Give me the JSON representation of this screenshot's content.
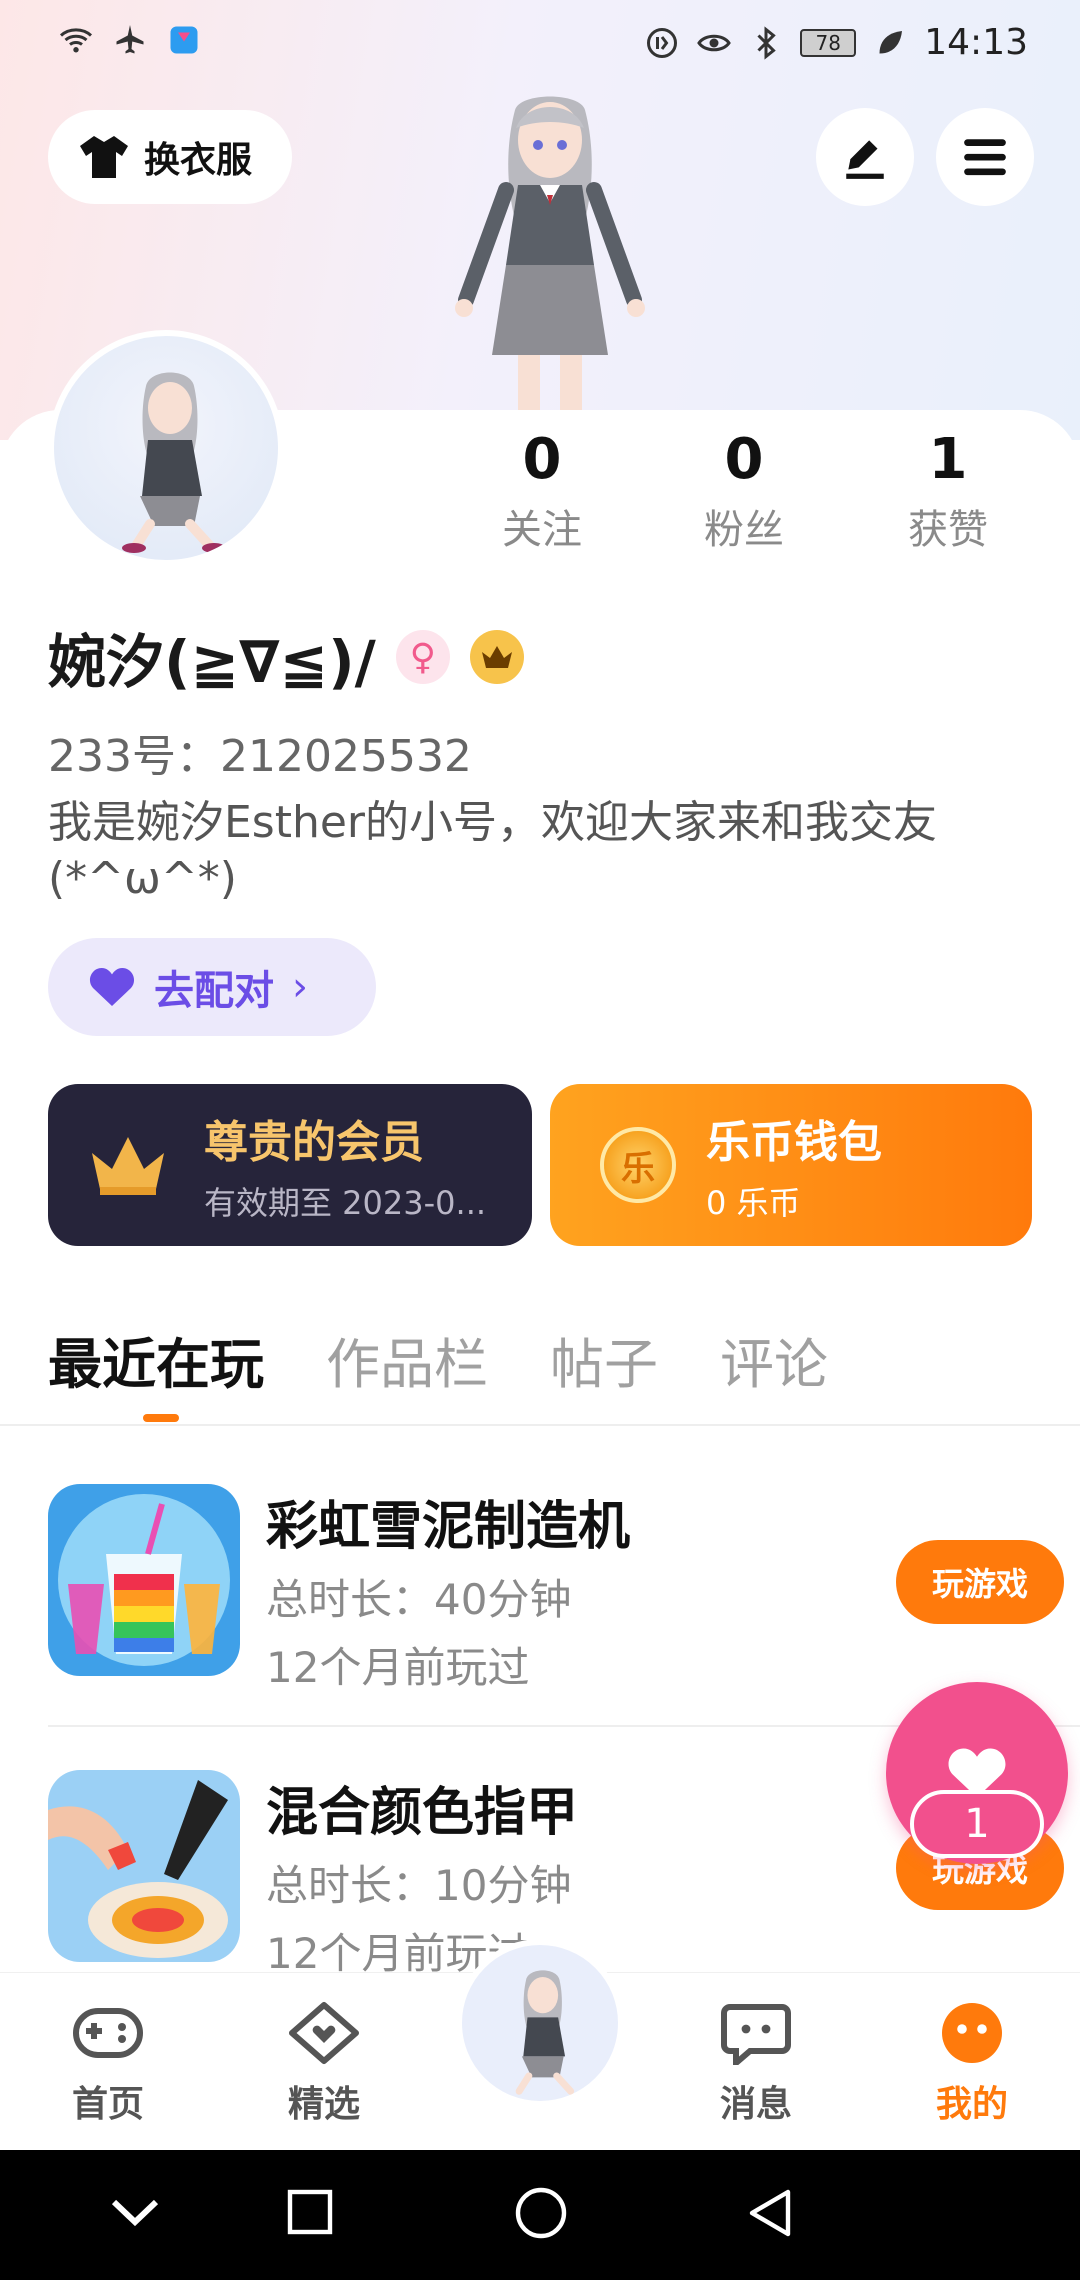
{
  "status_bar": {
    "time": "14:13",
    "battery": "78"
  },
  "header": {
    "outfit_label": "换衣服"
  },
  "profile": {
    "name": "婉汐(≧∇≦)/",
    "uid": "233号：212025532",
    "bio": "我是婉汐Esther的小号，欢迎大家来和我交友(*^ω^*)",
    "match_label": "去配对",
    "stats": [
      {
        "num": "0",
        "label": "关注"
      },
      {
        "num": "0",
        "label": "粉丝"
      },
      {
        "num": "1",
        "label": "获赞"
      }
    ]
  },
  "vip": {
    "title": "尊贵的会员",
    "subtitle": "有效期至 2023-0..."
  },
  "wallet": {
    "title": "乐币钱包",
    "subtitle": "0 乐币",
    "coin_char": "乐"
  },
  "tabs": [
    "最近在玩",
    "作品栏",
    "帖子",
    "评论"
  ],
  "games": [
    {
      "title": "彩虹雪泥制造机",
      "duration": "总时长：40分钟",
      "last_played": "12个月前玩过",
      "button": "玩游戏"
    },
    {
      "title": "混合颜色指甲",
      "duration": "总时长：10分钟",
      "last_played": "12个月前玩过",
      "button": "玩游戏"
    }
  ],
  "like_fab": {
    "count": "1"
  },
  "bottom_nav": [
    {
      "label": "首页",
      "icon": "gamepad-icon"
    },
    {
      "label": "精选",
      "icon": "heart-chat-icon"
    },
    {
      "label": "消息",
      "icon": "message-icon"
    },
    {
      "label": "我的",
      "icon": "profile-icon"
    }
  ],
  "colors": {
    "accent": "#ff7a0c",
    "vip_gold": "#f7c56c",
    "match_purple": "#6b4de6",
    "like_pink": "#f2508d"
  }
}
